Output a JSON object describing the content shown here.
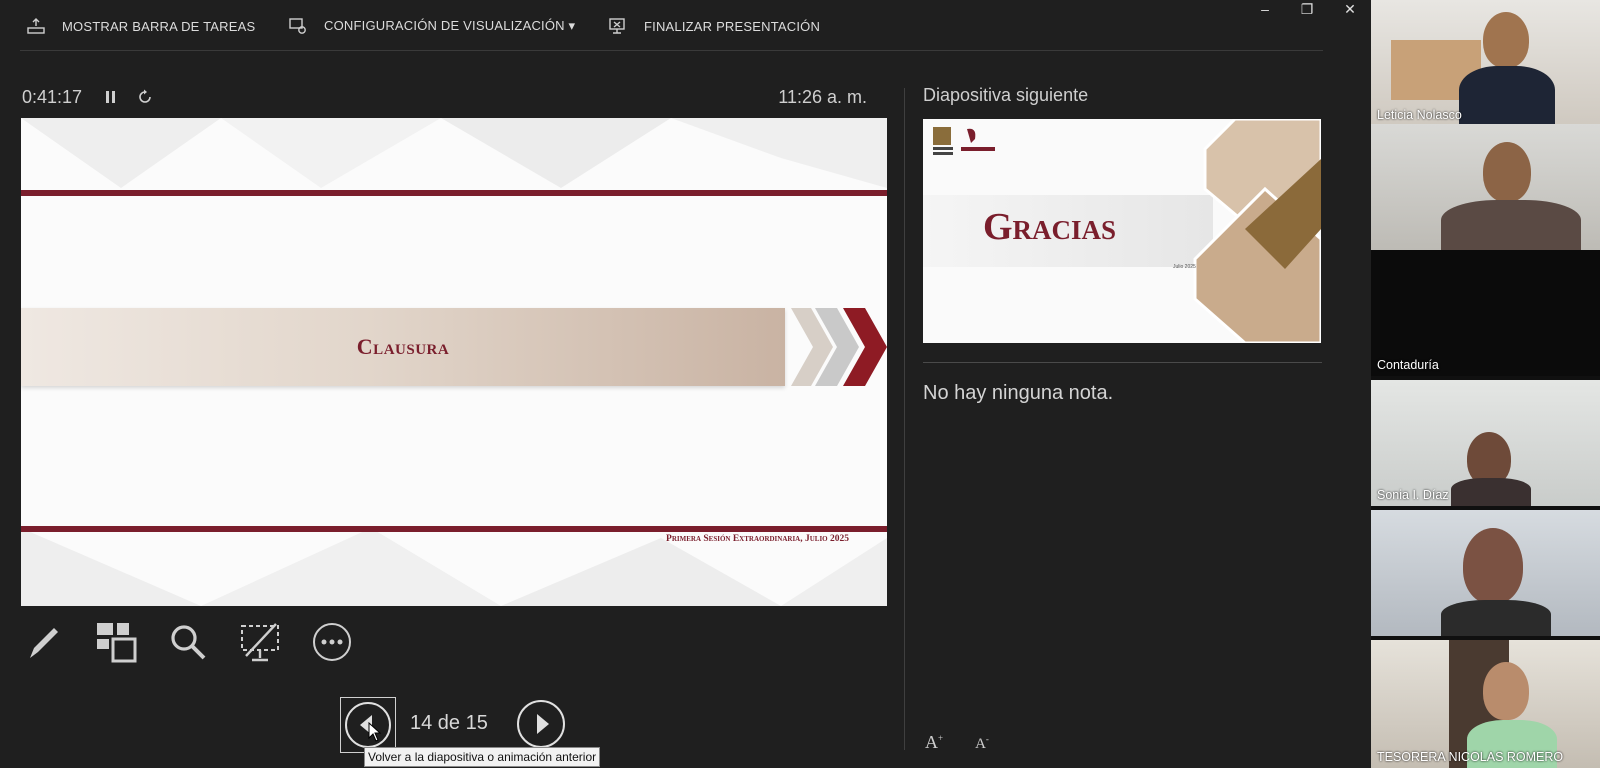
{
  "toolbar": {
    "taskbar_label": "MOSTRAR BARRA DE TAREAS",
    "display_settings_label": "CONFIGURACIÓN DE VISUALIZACIÓN ▾",
    "end_show_label": "FINALIZAR PRESENTACIÓN",
    "minimize": "–",
    "restore": "❐",
    "close": "✕"
  },
  "timer": {
    "elapsed": "0:41:17",
    "clock": "11:26 a. m."
  },
  "current_slide": {
    "title": "Clausura",
    "footer": "Primera Sesión Extraordinaria, Julio 2025"
  },
  "navigation": {
    "counter": "14 de 15",
    "tooltip": "Volver a la diapositiva o animación anterior"
  },
  "next_panel": {
    "label": "Diapositiva siguiente",
    "slide_title": "Gracias",
    "slide_date": "Julio 2025",
    "notes": "No hay ninguna nota."
  },
  "participants": [
    {
      "name": "Leticia Nolasco"
    },
    {
      "name": ""
    },
    {
      "name": "Contaduría"
    },
    {
      "name": "Sonia I. Díaz"
    },
    {
      "name": ""
    },
    {
      "name": "TESORERA NICOLAS ROMERO"
    }
  ],
  "colors": {
    "brand_red": "#7a1e2c",
    "background": "#1f1f1f"
  }
}
